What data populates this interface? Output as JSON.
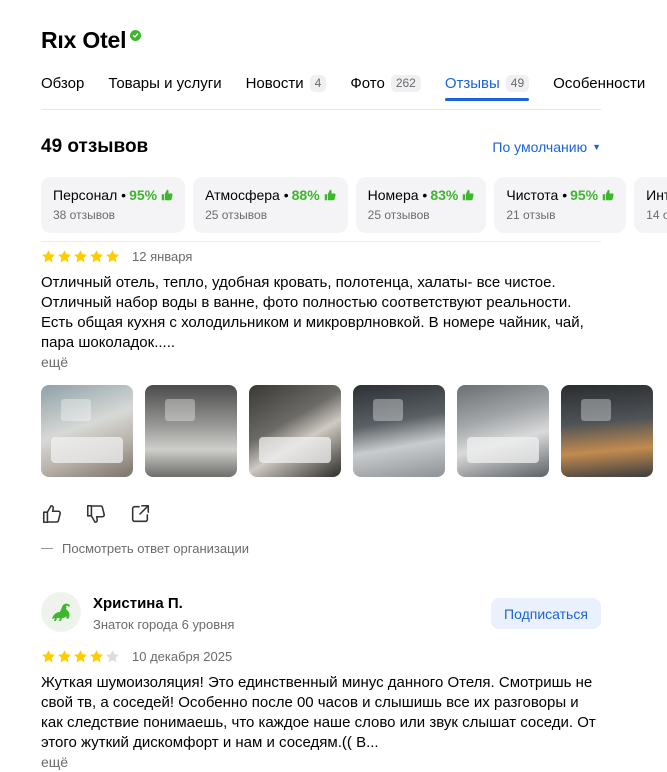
{
  "hotel": {
    "title": "Rıx Otel",
    "verified_icon": "verified-check-icon"
  },
  "tabs": [
    {
      "label": "Обзор",
      "count": ""
    },
    {
      "label": "Товары и услуги",
      "count": ""
    },
    {
      "label": "Новости",
      "count": "4"
    },
    {
      "label": "Фото",
      "count": "262"
    },
    {
      "label": "Отзывы",
      "count": "49"
    },
    {
      "label": "Особенности",
      "count": ""
    }
  ],
  "active_tab": "Отзывы",
  "reviews_header": {
    "count_label": "49 отзывов",
    "sort_label": "По умолчанию"
  },
  "aspects": [
    {
      "name": "Персонал",
      "percent": "95%",
      "reviews": "38 отзывов"
    },
    {
      "name": "Атмосфера",
      "percent": "88%",
      "reviews": "25 отзывов"
    },
    {
      "name": "Номера",
      "percent": "83%",
      "reviews": "25 отзывов"
    },
    {
      "name": "Чистота",
      "percent": "95%",
      "reviews": "21 отзыв"
    },
    {
      "name": "Инт",
      "percent": "",
      "reviews": "14 о"
    }
  ],
  "colors": {
    "accent": "#1a64db",
    "positive": "#3cb72b",
    "star": "#fc0",
    "muted": "#6b6b6b"
  },
  "reviews": [
    {
      "rating": 5,
      "date": "12 января",
      "text": "Отличный отель, тепло, удобная кровать, полотенца, халаты- все чистое. Отличный набор воды в ванне, фото полностью соответствуют реальности. Есть общая кухня с холодильником и микроврлновкой. В номере чайник, чай, пара шоколадок.....",
      "more_label": "ещё",
      "photos": 6,
      "org_reply_label": "Посмотреть ответ организации"
    },
    {
      "author": "Христина П.",
      "author_level": "Знаток города 6 уровня",
      "subscribe_label": "Подписаться",
      "rating": 4,
      "date": "10 декабря 2025",
      "text": "Жуткая шумоизоляция! Это единственный минус данного Отеля. Смотришь не свой тв, а соседей! Особенно после 00 часов и слышишь все их разговоры и как следствие понимаешь, что каждое наше слово или звук слышат соседи. От этого жуткий дискомфорт и нам и соседям.(( В...",
      "more_label": "ещё"
    }
  ]
}
